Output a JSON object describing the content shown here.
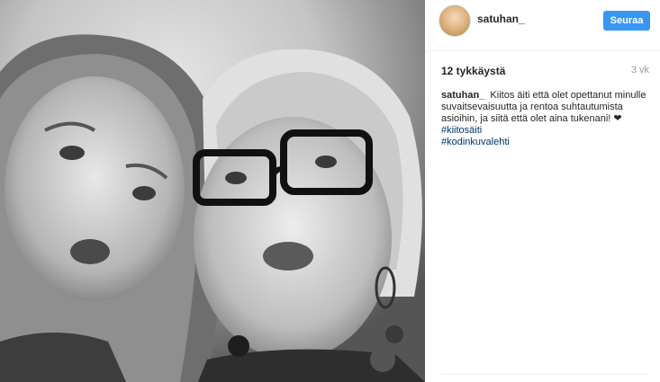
{
  "post": {
    "username": "satuhan_",
    "follow_label": "Seuraa",
    "likes": "12 tykkäystä",
    "time_ago": "3 vk",
    "caption_user": "satuhan_",
    "caption_text": "Kiitos äiti että olet opettanut minulle suvaitsevaisuutta ja rentoa suhtautumista asioihin, ja siitä että olet aina tukenani!",
    "heart": "❤",
    "hashtags": [
      "#kiitosäiti",
      "#kodinkuvalehti"
    ]
  },
  "colors": {
    "follow_button": "#3897f0",
    "hashtag": "#003569",
    "muted": "#999999"
  },
  "icons": {
    "heart": "heart-icon"
  }
}
